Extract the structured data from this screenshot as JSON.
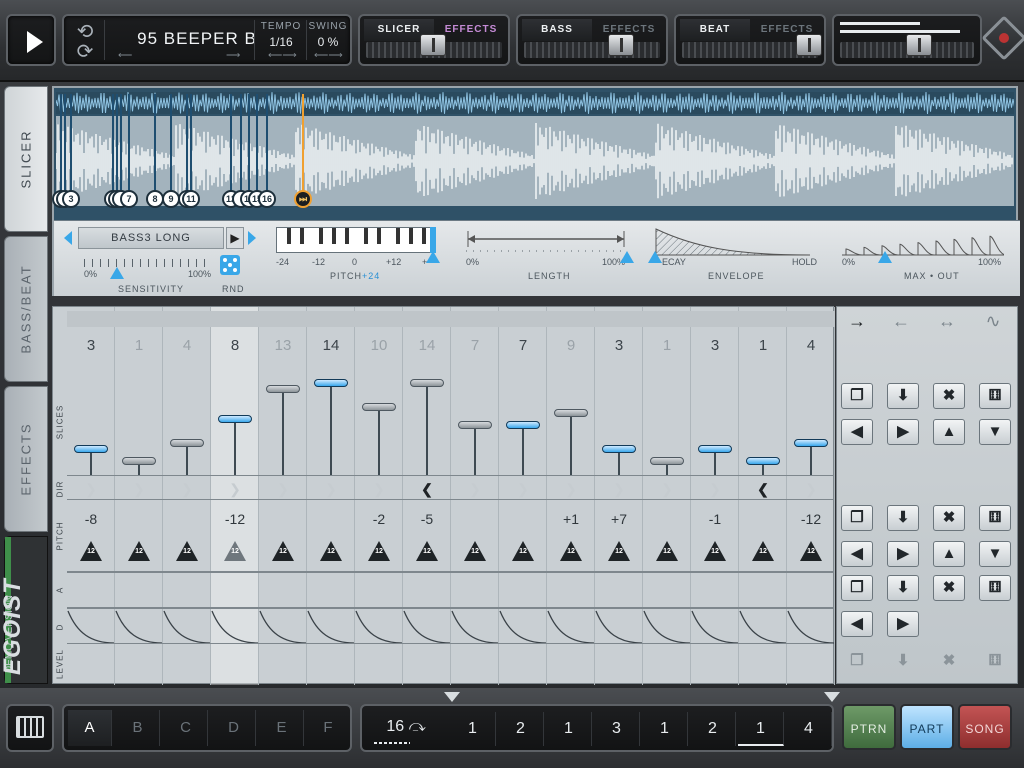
{
  "transport": {
    "play_icon": "play-icon"
  },
  "song": {
    "name": "95 BEEPER B",
    "tempo_label": "TEMPO",
    "tempo_value": "1/16",
    "swing_label": "SWING",
    "swing_value": "0 %"
  },
  "channels": [
    {
      "name": "SLICER",
      "effects": "EFFECTS",
      "fader": 0.48
    },
    {
      "name": "BASS",
      "effects": "EFFECTS",
      "fader": 0.72
    },
    {
      "name": "BEAT",
      "effects": "EFFECTS",
      "fader": 0.9
    }
  ],
  "master": {
    "fader": 0.68
  },
  "tabs": {
    "slicer": "SLICER",
    "bassbeat": "BASS/BEAT",
    "effects": "EFFECTS"
  },
  "brand": {
    "demo": "DEMO VERSION",
    "name": "EGOIST"
  },
  "slicer": {
    "markers": [
      "",
      "",
      "3",
      "",
      "",
      "",
      "7",
      "8",
      "9",
      "",
      "11",
      "12",
      "",
      "14",
      "15",
      "16"
    ],
    "preset": "BASS3 LONG",
    "sensitivity_label": "SENSITIVITY",
    "sens_min": "0%",
    "sens_max": "100%",
    "rnd_label": "RND",
    "pitch_label": "PITCH",
    "pitch_value": "+24",
    "pitch_scale": [
      "-24",
      "-12",
      "0",
      "+12",
      "+"
    ],
    "length_label": "LENGTH",
    "length_min": "0%",
    "length_max": "100%",
    "envelope_label": "ENVELOPE",
    "env_min": "ECAY",
    "env_max": "HOLD",
    "max_label": "MAX • OUT",
    "max_min": "0%",
    "max_max": "100%"
  },
  "grid": {
    "row_labels": {
      "slices": "SLICES",
      "dir": "DIR",
      "pitch": "PITCH",
      "a": "A",
      "d": "D",
      "level": "LEVEL"
    },
    "steps": [
      {
        "slice": "3",
        "level": 2,
        "dim": false,
        "sel": true,
        "dir": "fwd",
        "pitch": "-8"
      },
      {
        "slice": "1",
        "level": 0,
        "dim": true,
        "sel": false,
        "dir": "fwd",
        "pitch": ""
      },
      {
        "slice": "4",
        "level": 3,
        "dim": true,
        "sel": false,
        "dir": "fwd",
        "pitch": ""
      },
      {
        "slice": "8",
        "level": 7,
        "dim": false,
        "sel": true,
        "dir": "fwd",
        "pitch": "-12"
      },
      {
        "slice": "13",
        "level": 12,
        "dim": true,
        "sel": false,
        "dir": "fwd",
        "pitch": ""
      },
      {
        "slice": "14",
        "level": 13,
        "dim": false,
        "sel": true,
        "dir": "fwd",
        "pitch": ""
      },
      {
        "slice": "10",
        "level": 9,
        "dim": true,
        "sel": false,
        "dir": "fwd",
        "pitch": "-2"
      },
      {
        "slice": "14",
        "level": 13,
        "dim": true,
        "sel": false,
        "dir": "rev",
        "pitch": "-5"
      },
      {
        "slice": "7",
        "level": 6,
        "dim": true,
        "sel": false,
        "dir": "fwd",
        "pitch": ""
      },
      {
        "slice": "7",
        "level": 6,
        "dim": false,
        "sel": true,
        "dir": "fwd",
        "pitch": ""
      },
      {
        "slice": "9",
        "level": 8,
        "dim": true,
        "sel": false,
        "dir": "fwd",
        "pitch": "+1"
      },
      {
        "slice": "3",
        "level": 2,
        "dim": false,
        "sel": true,
        "dir": "fwd",
        "pitch": "+7"
      },
      {
        "slice": "1",
        "level": 0,
        "dim": true,
        "sel": false,
        "dir": "fwd",
        "pitch": ""
      },
      {
        "slice": "3",
        "level": 2,
        "dim": false,
        "sel": true,
        "dir": "fwd",
        "pitch": "-1"
      },
      {
        "slice": "1",
        "level": 0,
        "dim": false,
        "sel": true,
        "dir": "rev",
        "pitch": ""
      },
      {
        "slice": "4",
        "level": 3,
        "dim": false,
        "sel": true,
        "dir": "fwd",
        "pitch": "-12"
      }
    ],
    "pitch_badge": "12"
  },
  "right": {
    "directions": [
      "→",
      "←",
      "↔",
      "∿"
    ],
    "icons": {
      "copy": "copy-icon",
      "paste": "paste-icon",
      "clear": "clear-icon",
      "random": "dice-icon",
      "left": "shift-left-icon",
      "right": "shift-right-icon",
      "up": "shift-up-icon",
      "down": "shift-down-icon"
    }
  },
  "bottom": {
    "patterns": [
      "A",
      "B",
      "C",
      "D",
      "E",
      "F"
    ],
    "length": "16",
    "sequence": [
      "1",
      "2",
      "1",
      "3",
      "1",
      "2",
      "1",
      "4"
    ],
    "modes": {
      "ptrn": "PTRN",
      "part": "PART",
      "song": "SONG"
    }
  }
}
